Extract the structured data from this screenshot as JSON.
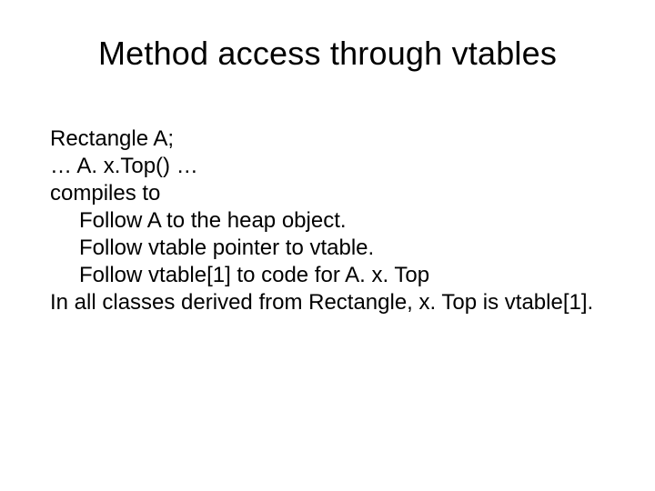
{
  "title": "Method access through vtables",
  "lines": {
    "l1": "Rectangle A;",
    "l2": "… A. x.Top() …",
    "l3": "compiles to",
    "l4": "Follow A to the heap object.",
    "l5": "Follow vtable pointer to vtable.",
    "l6": "Follow vtable[1] to code for A. x. Top",
    "l7": "In all classes derived from Rectangle, x. Top is vtable[1]."
  }
}
